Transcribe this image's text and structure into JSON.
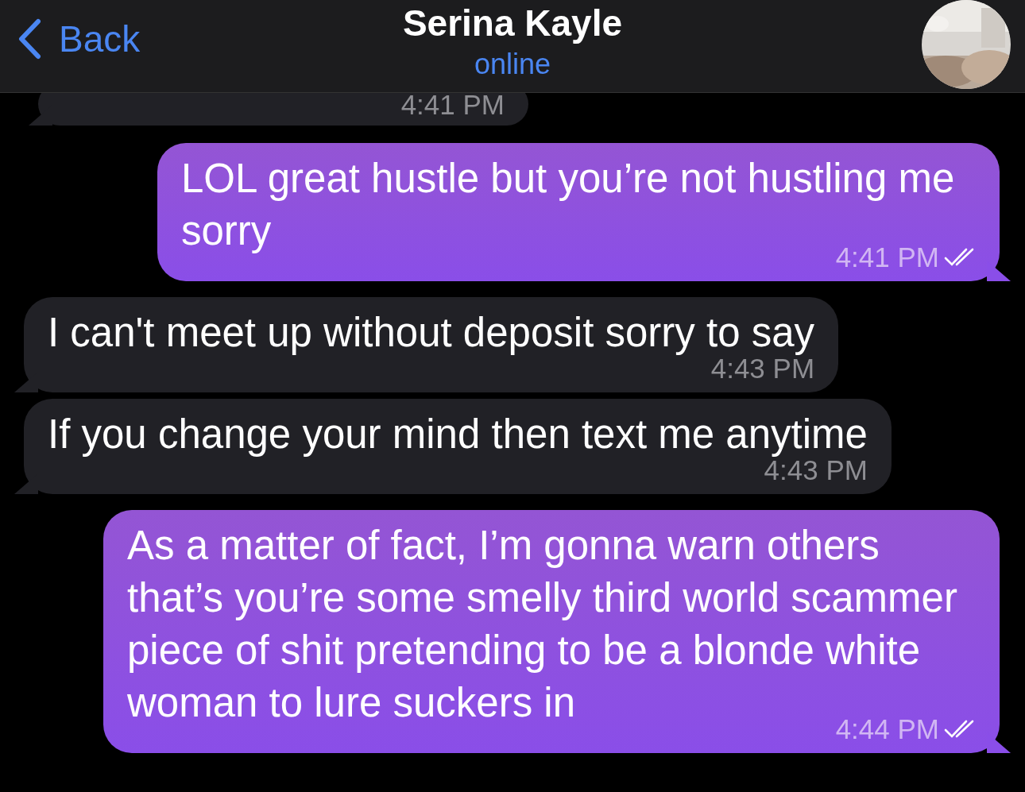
{
  "header": {
    "back": "Back",
    "name": "Serina Kayle",
    "status": "online"
  },
  "messages": [
    {
      "kind": "incoming",
      "time": "4:41 PM"
    },
    {
      "kind": "outgoing",
      "text": "LOL great hustle but you’re not hustling me sorry",
      "time": "4:41 PM",
      "read": true
    },
    {
      "kind": "incoming",
      "text": "I can't meet up without deposit sorry to say",
      "time": "4:43 PM"
    },
    {
      "kind": "incoming",
      "text": "If you change your mind then text me anytime",
      "time": "4:43 PM"
    },
    {
      "kind": "outgoing",
      "text": "As a matter of fact, I’m gonna warn others that’s you’re some smelly third world scammer piece of shit pretending to be a blonde white woman to lure suckers in",
      "time": "4:44 PM",
      "read": true
    }
  ]
}
